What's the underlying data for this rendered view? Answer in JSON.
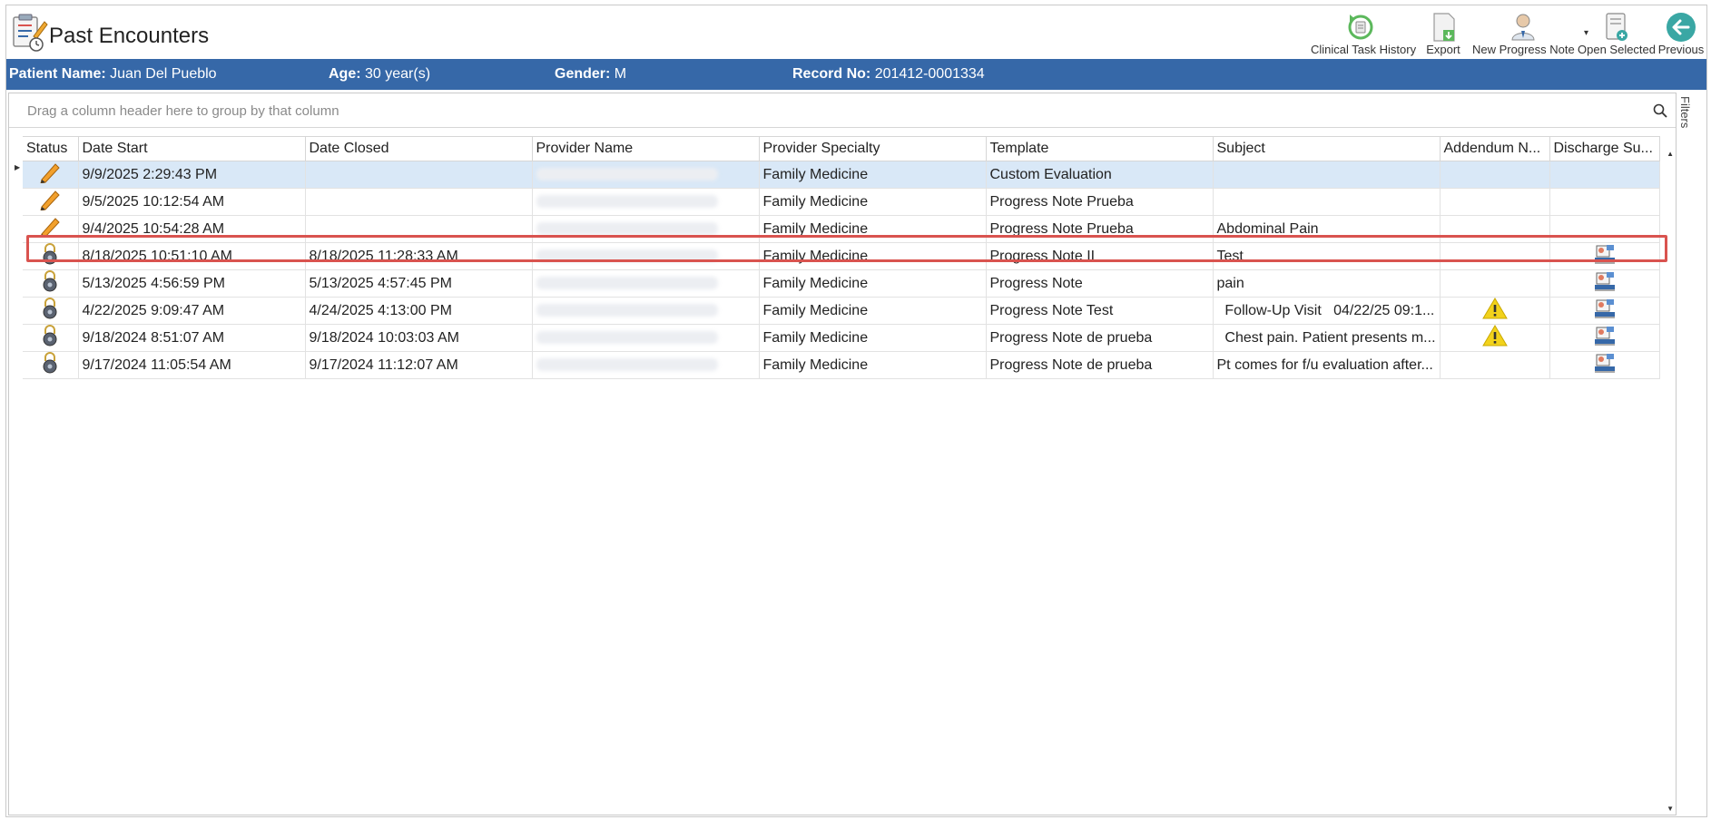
{
  "window": {
    "title": "Past Encounters"
  },
  "toolbar": {
    "items": [
      {
        "label": "Clinical Task History",
        "icon": "clinical-task-history-icon"
      },
      {
        "label": "Export",
        "icon": "export-icon"
      },
      {
        "label": "New Progress Note",
        "icon": "new-progress-note-icon"
      },
      {
        "label": "Open Selected",
        "icon": "open-selected-icon"
      },
      {
        "label": "Previous",
        "icon": "previous-arrow-icon"
      }
    ]
  },
  "patient": {
    "name_label": "Patient Name:",
    "name_value": "Juan Del Pueblo",
    "age_label": "Age:",
    "age_value": "30 year(s)",
    "gender_label": "Gender:",
    "gender_value": "M",
    "record_label": "Record No:",
    "record_value": "201412-0001334"
  },
  "grid": {
    "group_hint": "Drag a column header here to group by that column",
    "filters_label": "Filters",
    "columns": [
      "Status",
      "Date Start",
      "Date Closed",
      "Provider Name",
      "Provider Specialty",
      "Template",
      "Subject",
      "Addendum N...",
      "Discharge Su..."
    ],
    "rows": [
      {
        "status": "pencil",
        "date_start": "9/9/2025 2:29:43 PM",
        "date_closed": "",
        "specialty": "Family Medicine",
        "template": "Custom Evaluation",
        "subject": "",
        "addendum": false,
        "discharge": false,
        "selected": true
      },
      {
        "status": "pencil",
        "date_start": "9/5/2025 10:12:54 AM",
        "date_closed": "",
        "specialty": "Family Medicine",
        "template": "Progress Note Prueba",
        "subject": "",
        "addendum": false,
        "discharge": false
      },
      {
        "status": "pencil",
        "date_start": "9/4/2025 10:54:28 AM",
        "date_closed": "",
        "specialty": "Family Medicine",
        "template": "Progress Note Prueba",
        "subject": "Abdominal Pain",
        "addendum": false,
        "discharge": false
      },
      {
        "status": "lock",
        "date_start": "8/18/2025 10:51:10 AM",
        "date_closed": "8/18/2025 11:28:33 AM",
        "specialty": "Family Medicine",
        "template": "Progress Note II",
        "subject": "Test",
        "addendum": false,
        "discharge": true,
        "highlighted": true
      },
      {
        "status": "lock",
        "date_start": "5/13/2025 4:56:59 PM",
        "date_closed": "5/13/2025 4:57:45 PM",
        "specialty": "Family Medicine",
        "template": "Progress Note",
        "subject": "pain",
        "addendum": false,
        "discharge": true
      },
      {
        "status": "lock",
        "date_start": "4/22/2025 9:09:47 AM",
        "date_closed": "4/24/2025 4:13:00 PM",
        "specialty": "Family Medicine",
        "template": "Progress Note Test",
        "subject": "  Follow-Up Visit   04/22/25 09:1...",
        "addendum": true,
        "discharge": true
      },
      {
        "status": "lock",
        "date_start": "9/18/2024 8:51:07 AM",
        "date_closed": "9/18/2024 10:03:03 AM",
        "specialty": "Family Medicine",
        "template": "Progress Note de prueba",
        "subject": "  Chest pain. Patient presents m...",
        "addendum": true,
        "discharge": true
      },
      {
        "status": "lock",
        "date_start": "9/17/2024 11:05:54 AM",
        "date_closed": "9/17/2024 11:12:07 AM",
        "specialty": "Family Medicine",
        "template": "Progress Note de prueba",
        "subject": "Pt comes for f/u evaluation after...",
        "addendum": false,
        "discharge": true
      }
    ]
  },
  "colors": {
    "banner": "#3668a8",
    "selected_row": "#d9e8f7",
    "highlight_border": "#d9534f",
    "warning": "#f2d21b"
  }
}
